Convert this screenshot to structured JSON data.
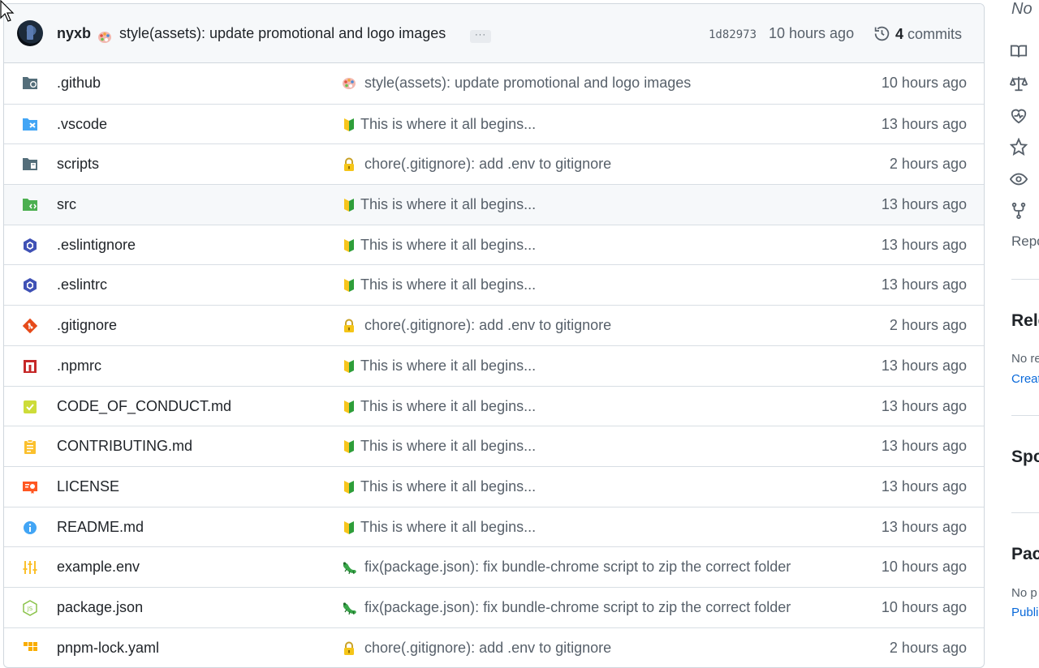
{
  "latest_commit": {
    "author": "nyxb",
    "message": "style(assets): update promotional and logo images",
    "more_label": "···",
    "sha": "1d82973",
    "time": "10 hours ago",
    "commits_count": "4",
    "commits_label": "commits"
  },
  "files": [
    {
      "name": ".github",
      "icon": "folder-github-icon",
      "commit_icon": "palette-icon",
      "commit": "style(assets): update promotional and logo images",
      "time": "10 hours ago"
    },
    {
      "name": ".vscode",
      "icon": "folder-vscode-icon",
      "commit_icon": "beginner-icon",
      "commit": "This is where it all begins...",
      "time": "13 hours ago"
    },
    {
      "name": "scripts",
      "icon": "folder-scripts-icon",
      "commit_icon": "lock-icon",
      "commit": "chore(.gitignore): add .env to gitignore",
      "time": "2 hours ago"
    },
    {
      "name": "src",
      "icon": "folder-src-icon",
      "commit_icon": "beginner-icon",
      "commit": "This is where it all begins...",
      "time": "13 hours ago"
    },
    {
      "name": ".eslintignore",
      "icon": "eslint-icon",
      "commit_icon": "beginner-icon",
      "commit": "This is where it all begins...",
      "time": "13 hours ago"
    },
    {
      "name": ".eslintrc",
      "icon": "eslint-icon",
      "commit_icon": "beginner-icon",
      "commit": "This is where it all begins...",
      "time": "13 hours ago"
    },
    {
      "name": ".gitignore",
      "icon": "git-icon",
      "commit_icon": "lock-icon",
      "commit": "chore(.gitignore): add .env to gitignore",
      "time": "2 hours ago"
    },
    {
      "name": ".npmrc",
      "icon": "npm-icon",
      "commit_icon": "beginner-icon",
      "commit": "This is where it all begins...",
      "time": "13 hours ago"
    },
    {
      "name": "CODE_OF_CONDUCT.md",
      "icon": "conduct-icon",
      "commit_icon": "beginner-icon",
      "commit": "This is where it all begins...",
      "time": "13 hours ago"
    },
    {
      "name": "CONTRIBUTING.md",
      "icon": "contributing-icon",
      "commit_icon": "beginner-icon",
      "commit": "This is where it all begins...",
      "time": "13 hours ago"
    },
    {
      "name": "LICENSE",
      "icon": "license-icon",
      "commit_icon": "beginner-icon",
      "commit": "This is where it all begins...",
      "time": "13 hours ago"
    },
    {
      "name": "README.md",
      "icon": "info-icon",
      "commit_icon": "beginner-icon",
      "commit": "This is where it all begins...",
      "time": "13 hours ago"
    },
    {
      "name": "example.env",
      "icon": "tune-icon",
      "commit_icon": "bug-icon",
      "commit": "fix(package.json): fix bundle-chrome script to zip the correct folder",
      "time": "10 hours ago"
    },
    {
      "name": "package.json",
      "icon": "nodejs-icon",
      "commit_icon": "bug-icon",
      "commit": "fix(package.json): fix bundle-chrome script to zip the correct folder",
      "time": "10 hours ago"
    },
    {
      "name": "pnpm-lock.yaml",
      "icon": "pnpm-icon",
      "commit_icon": "lock-icon",
      "commit": "chore(.gitignore): add .env to gitignore",
      "time": "2 hours ago"
    }
  ],
  "sidebar": {
    "about_text": "No",
    "repo_label": "Repo",
    "releases_heading": "Rele",
    "releases_text": "No re",
    "releases_link": "Creat",
    "sponsor_heading": "Spo",
    "packages_heading": "Pac",
    "packages_text": "No p",
    "packages_link": "Publi"
  },
  "colors": {
    "accent_link": "#0969da",
    "muted_text": "#57606a",
    "border": "#d0d7de"
  }
}
